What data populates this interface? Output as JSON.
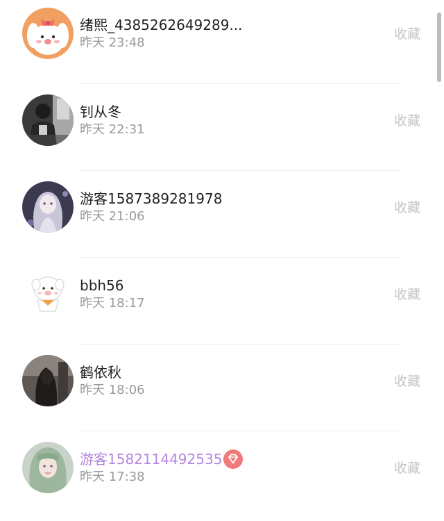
{
  "list": {
    "items": [
      {
        "name": "绪熙_4385262649289...",
        "time": "昨天 23:48",
        "action": "收藏",
        "avatar": "cartoon-dog-avatar"
      },
      {
        "name": "钊从冬",
        "time": "昨天 22:31",
        "action": "收藏",
        "avatar": "dark-photo-avatar"
      },
      {
        "name": "游客1587389281978",
        "time": "昨天 21:06",
        "action": "收藏",
        "avatar": "anime-girl-avatar"
      },
      {
        "name": "bbh56",
        "time": "昨天 18:17",
        "action": "收藏",
        "avatar": "white-puppy-avatar"
      },
      {
        "name": "鹤依秋",
        "time": "昨天 18:06",
        "action": "收藏",
        "avatar": "dark-portrait-avatar"
      },
      {
        "name": "游客1582114492535",
        "time": "昨天 17:38",
        "action": "收藏",
        "avatar": "green-hair-avatar",
        "vip": true
      }
    ]
  },
  "colors": {
    "name_text": "#222222",
    "vip_name_text": "#b585e0",
    "time_text": "#9a9a9a",
    "action_text": "#c6c6c6",
    "vip_badge": "#f07a7a",
    "divider": "#efefef"
  },
  "icons": {
    "vip_badge": "diamond-icon"
  }
}
